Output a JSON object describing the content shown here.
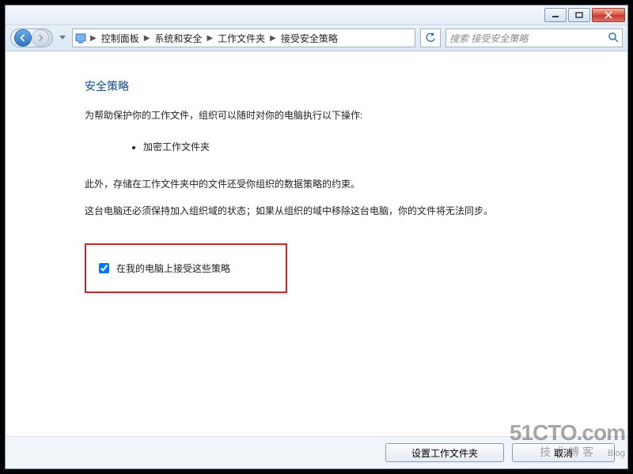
{
  "breadcrumb": {
    "items": [
      "控制面板",
      "系统和安全",
      "工作文件夹",
      "接受安全策略"
    ]
  },
  "search": {
    "placeholder": "搜索 接受安全策略"
  },
  "page": {
    "heading": "安全策略",
    "intro": "为帮助保护你的工作文件，组织可以随时对你的电脑执行以下操作:",
    "bullet1": "加密工作文件夹",
    "para2": "此外，存储在工作文件夹中的文件还受你组织的数据策略的约束。",
    "para3": "这台电脑还必须保持加入组织域的状态；如果从组织的域中移除这台电脑，你的文件将无法同步。",
    "checkbox_label": "在我的电脑上接受这些策略"
  },
  "buttons": {
    "primary": "设置工作文件夹",
    "cancel": "取消"
  },
  "watermark": {
    "line1": "51CTO.com",
    "line2": "技术博客",
    "tag": "Blog"
  }
}
